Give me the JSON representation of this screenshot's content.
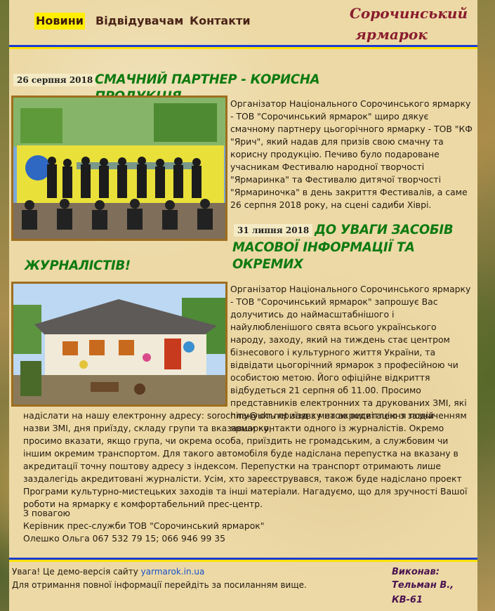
{
  "nav": {
    "items": [
      "Новини",
      "Відвідувачам",
      "Контакти"
    ]
  },
  "brand": {
    "line1": "Сорочинський",
    "line2": "ярмарок"
  },
  "colors": {
    "accent_yellow": "#ffee00",
    "stripe_blue": "#1a3ccf",
    "headline_green": "#0e7a10",
    "brand_red": "#8a1c2e"
  },
  "articles": [
    {
      "date": "26 серпня 2018",
      "headline": "Смачний партнер - корисна продукція",
      "image": "group-photo",
      "text": "    Організатор Національного Сорочинського ярмарку - ТОВ \"Сорочинський ярмарок\" щиро дякує смачному партнеру цьогорічного ярмарку - ТОВ \"КФ \"Ярич\", який надав для призів свою смачну та корисну продукцію. Печиво було подароване учасникам Фестивалю народної творчості \"Ярмаринка\" та Фестивалю дитячої творчості \"Ярмариночка\" в день закриття Фестивалів, а саме 26 серпня 2018 року, на сцені садиби Хіврі."
    },
    {
      "date": "31 липня 2018",
      "headline_line1": "До уваги засобів",
      "headline_line2": "масової інформації та окремих",
      "headline_line3": "журналістів!",
      "image": "hut-photo",
      "text_beside": "    Організатор Національного Сорочинського ярмарку - ТОВ \"Сорочинський ярмарок\" запрошує Вас долучитись до наймасштабнішого і найулюбленішого свята всього українського народу, заходу, який на тиждень стає центром бізнесового і культурного життя України, та відвідати цьогорічний ярмарок з професійною чи особистою метою. Його офіційне відкриття відбудеться 21 серпня об 11.00. Просимо представників електронних та друкованих ЗМІ, які планують приїзд з метою висвітлення подій ярмарку,",
      "text_full": "надіслати на нашу електронну адресу: sorochiny@ukr.net заявку на акредитацію з зазначенням назви ЗМІ, дня приїзду, складу групи та вказавши контакти одного із журналістів. Окремо просимо вказати, якщо група, чи окрема особа, приїздить не громадським, а службовим чи іншим окремим транспортом. Для такого автомобіля буде надіслана перепустка на вказану в акредитації точну поштову адресу з індексом. Перепустки на транспорт отримають лише заздалегідь акредитовані журналісти. Усім, хто зареєструвався, також буде надіслано проект Програми культурно-мистецьких заходів та інші матеріали. Нагадуємо, що для зручності Вашої роботи на ярмарку є комфортабельний прес-центр.",
      "closing": "З повагою",
      "signature_1": "Керівник прес-служби ТОВ \"Сорочинський ярмарок\"",
      "signature_2": "Олешко Ольга 067 532 79 15; 066 946 99 35"
    }
  ],
  "footer": {
    "notice_prefix": "Увага! Це демо-версія сайту ",
    "link": "yarmarok.in.ua",
    "notice_line2": "Для отримання повної інформації перейдіть за посиланням вище.",
    "credit_label": "Виконав:",
    "credit_name": "Тельман В., КВ-61"
  }
}
